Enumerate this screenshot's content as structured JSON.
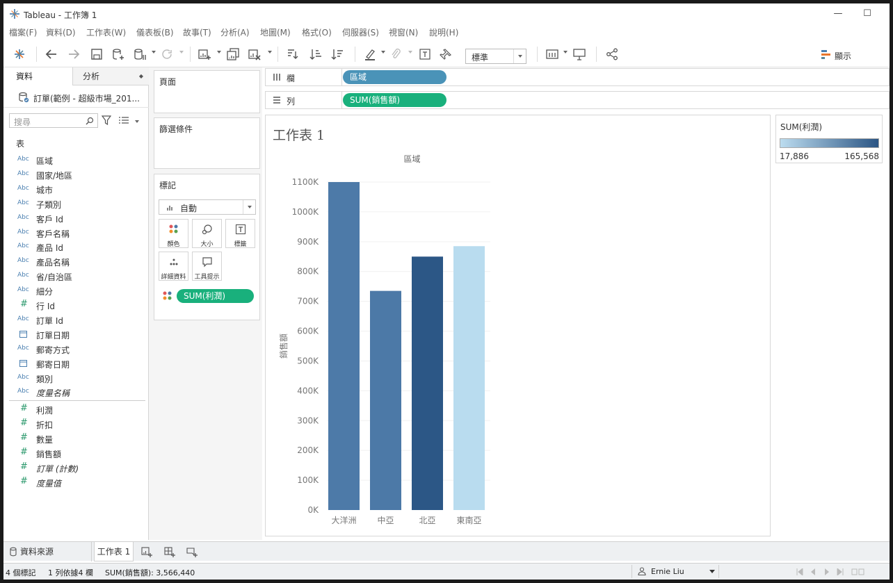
{
  "window": {
    "title": "Tableau - 工作簿 1",
    "minimize": "—",
    "maximize": "☐",
    "close": "✕"
  },
  "menu": [
    "檔案(F)",
    "資料(D)",
    "工作表(W)",
    "儀表板(B)",
    "故事(T)",
    "分析(A)",
    "地圖(M)",
    "格式(O)",
    "伺服器(S)",
    "視窗(N)",
    "說明(H)"
  ],
  "toolbar": {
    "fit_value": "標準",
    "show_me_label": "顯示"
  },
  "left_panel": {
    "tab_data": "資料",
    "tab_analytics": "分析",
    "datasource": "訂單(範例 - 超級市場_201...",
    "search_placeholder": "搜尋",
    "section_label": "表",
    "dimensions": [
      {
        "type": "Abc",
        "name": "區域"
      },
      {
        "type": "Abc",
        "name": "國家/地區"
      },
      {
        "type": "Abc",
        "name": "城市"
      },
      {
        "type": "Abc",
        "name": "子類別"
      },
      {
        "type": "Abc",
        "name": "客戶 Id"
      },
      {
        "type": "Abc",
        "name": "客戶名稱"
      },
      {
        "type": "Abc",
        "name": "產品 Id"
      },
      {
        "type": "Abc",
        "name": "產品名稱"
      },
      {
        "type": "Abc",
        "name": "省/自治區"
      },
      {
        "type": "Abc",
        "name": "細分"
      },
      {
        "type": "#",
        "name": "行 Id"
      },
      {
        "type": "Abc",
        "name": "訂單 Id"
      },
      {
        "type": "date",
        "name": "訂單日期"
      },
      {
        "type": "Abc",
        "name": "郵寄方式"
      },
      {
        "type": "date",
        "name": "郵寄日期"
      },
      {
        "type": "Abc",
        "name": "類別"
      },
      {
        "type": "Abc",
        "name": "度量名稱",
        "italic": true
      }
    ],
    "measures": [
      {
        "type": "#",
        "name": "利潤"
      },
      {
        "type": "#",
        "name": "折扣"
      },
      {
        "type": "#",
        "name": "數量"
      },
      {
        "type": "#",
        "name": "銷售額"
      },
      {
        "type": "#",
        "name": "訂單 (計數)",
        "italic": true
      },
      {
        "type": "#",
        "name": "度量值",
        "italic": true
      }
    ]
  },
  "cards": {
    "pages": "頁面",
    "filters": "篩選條件",
    "marks": "標記",
    "mark_type": "自動",
    "mark_buttons": [
      "顏色",
      "大小",
      "標籤",
      "詳細資料",
      "工具提示"
    ],
    "color_pill": "SUM(利潤)"
  },
  "shelves": {
    "columns_label": "欄",
    "columns_pill": "區域",
    "rows_label": "列",
    "rows_pill": "SUM(銷售額)"
  },
  "sheet": {
    "title": "工作表 1"
  },
  "legend": {
    "title": "SUM(利潤)",
    "min": "17,886",
    "max": "165,568"
  },
  "chart_data": {
    "type": "bar",
    "title": "區域",
    "ylabel": "銷售額",
    "categories": [
      "大洋洲",
      "中亞",
      "北亞",
      "東南亞"
    ],
    "values": [
      1100000,
      735000,
      850000,
      885000
    ],
    "bar_colors": [
      "#4d7aa8",
      "#4c79a7",
      "#2c5786",
      "#b9dcef"
    ],
    "ylim": [
      0,
      1100000
    ],
    "yticks": [
      "0K",
      "100K",
      "200K",
      "300K",
      "400K",
      "500K",
      "600K",
      "700K",
      "800K",
      "900K",
      "1000K",
      "1100K"
    ],
    "grid": true
  },
  "sheet_tabs": {
    "datasource": "資料來源",
    "sheet": "工作表 1"
  },
  "status": {
    "marks": "4 個標記",
    "rows_cols": "1 列依據4 欄",
    "sum": "SUM(銷售額): 3,566,440",
    "user": "Ernie Liu"
  }
}
